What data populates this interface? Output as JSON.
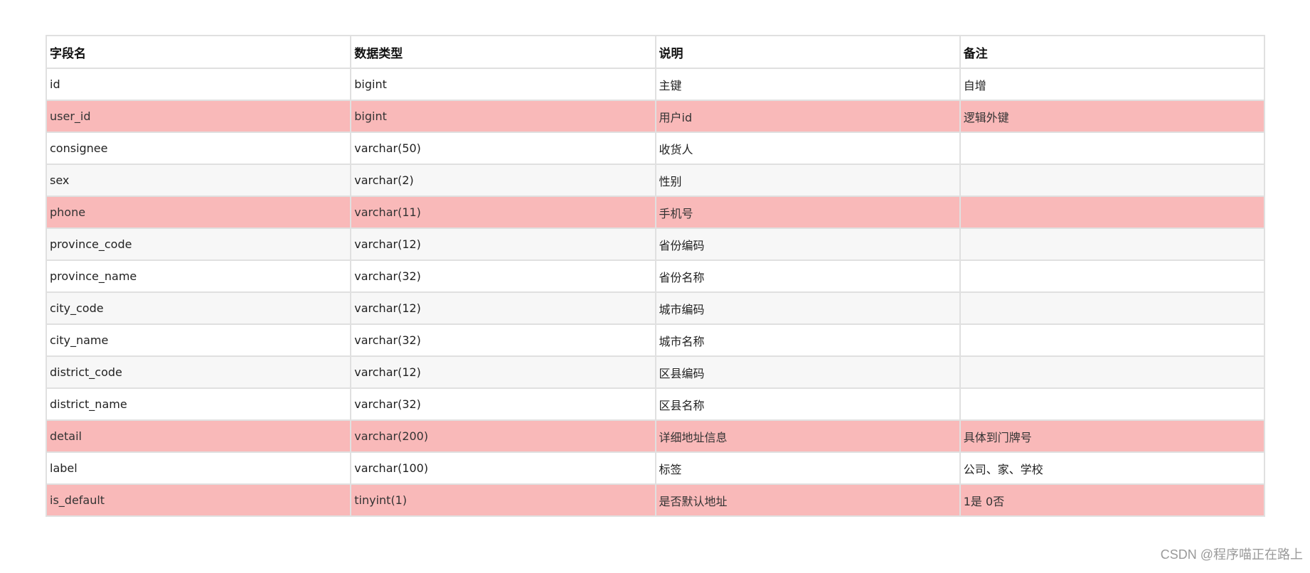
{
  "table": {
    "headers": [
      "字段名",
      "数据类型",
      "说明",
      "备注"
    ],
    "rows": [
      {
        "cells": [
          "id",
          "bigint",
          "主键",
          "自增"
        ],
        "style": "white"
      },
      {
        "cells": [
          "user_id",
          "bigint",
          "用户id",
          "逻辑外键"
        ],
        "style": "highlight"
      },
      {
        "cells": [
          "consignee",
          "varchar(50)",
          "收货人",
          ""
        ],
        "style": "white"
      },
      {
        "cells": [
          "sex",
          "varchar(2)",
          "性别",
          ""
        ],
        "style": "gray"
      },
      {
        "cells": [
          "phone",
          "varchar(11)",
          "手机号",
          ""
        ],
        "style": "highlight"
      },
      {
        "cells": [
          "province_code",
          "varchar(12)",
          "省份编码",
          ""
        ],
        "style": "gray"
      },
      {
        "cells": [
          "province_name",
          "varchar(32)",
          "省份名称",
          ""
        ],
        "style": "white"
      },
      {
        "cells": [
          "city_code",
          "varchar(12)",
          "城市编码",
          ""
        ],
        "style": "gray"
      },
      {
        "cells": [
          "city_name",
          "varchar(32)",
          "城市名称",
          ""
        ],
        "style": "white"
      },
      {
        "cells": [
          "district_code",
          "varchar(12)",
          "区县编码",
          ""
        ],
        "style": "gray"
      },
      {
        "cells": [
          "district_name",
          "varchar(32)",
          "区县名称",
          ""
        ],
        "style": "white"
      },
      {
        "cells": [
          "detail",
          "varchar(200)",
          "详细地址信息",
          "具体到门牌号"
        ],
        "style": "highlight"
      },
      {
        "cells": [
          "label",
          "varchar(100)",
          "标签",
          "公司、家、学校"
        ],
        "style": "white"
      },
      {
        "cells": [
          "is_default",
          "tinyint(1)",
          "是否默认地址",
          "1是 0否"
        ],
        "style": "highlight"
      }
    ]
  },
  "colors": {
    "highlight": "#f9b9b9",
    "gray_row": "#f7f7f7",
    "border": "#e0e0e0"
  },
  "watermark": "CSDN @程序喵正在路上"
}
